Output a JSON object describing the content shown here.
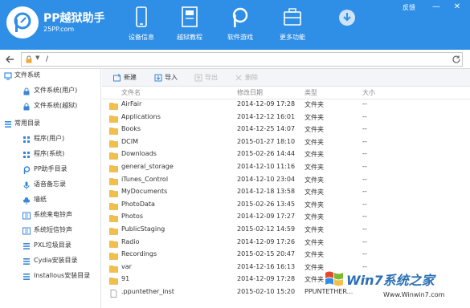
{
  "colors": {
    "header_bg": "#2f8fe6",
    "folder": "#f2c04a",
    "folder_dark": "#d9a12b",
    "accent": "#2f8fe6"
  },
  "header": {
    "brand": "PP越狱助手",
    "brand_url": "25PP.com",
    "feedback": "反馈",
    "nav": [
      {
        "label": "设备信息",
        "icon": "phone-icon"
      },
      {
        "label": "越狱教程",
        "icon": "book-icon"
      },
      {
        "label": "软件游戏",
        "icon": "pp-app-icon"
      },
      {
        "label": "更多功能",
        "icon": "toolbox-icon"
      },
      {
        "label": "",
        "icon": "download-icon"
      }
    ],
    "window_controls": [
      "minimize-icon",
      "close-icon"
    ]
  },
  "address": {
    "path": "/"
  },
  "sidebar": {
    "sections": [
      {
        "label": "文件系统",
        "icon": "monitor-icon",
        "items": [
          {
            "label": "文件系统(用户)",
            "icon": "lock-icon"
          },
          {
            "label": "文件系统(越狱)",
            "icon": "lock-icon"
          }
        ]
      },
      {
        "label": "常用目录",
        "icon": "list-icon",
        "items": [
          {
            "label": "程序(用户)",
            "icon": "apps-icon"
          },
          {
            "label": "程序(系统)",
            "icon": "apps-icon"
          },
          {
            "label": "PP助手目录",
            "icon": "pp-icon"
          },
          {
            "label": "语音备忘录",
            "icon": "mic-icon"
          },
          {
            "label": "墙纸",
            "icon": "flower-icon"
          },
          {
            "label": "系统来电铃声",
            "icon": "ringtone-icon"
          },
          {
            "label": "系统短信铃声",
            "icon": "ringtone-icon"
          },
          {
            "label": "PXL垃圾目录",
            "icon": "list-icon"
          },
          {
            "label": "Cydia安装目录",
            "icon": "list-icon"
          },
          {
            "label": "Installous安装目录",
            "icon": "list-icon"
          }
        ]
      }
    ]
  },
  "toolbar": {
    "buttons": [
      {
        "label": "新建",
        "icon": "new-folder-icon",
        "enabled": true
      },
      {
        "label": "导入",
        "icon": "import-icon",
        "enabled": true
      },
      {
        "label": "导出",
        "icon": "export-icon",
        "enabled": false
      },
      {
        "label": "删除",
        "icon": "delete-icon",
        "enabled": false
      }
    ]
  },
  "table": {
    "columns": [
      "文件名",
      "修改日期",
      "类型",
      "大小"
    ],
    "rows": [
      {
        "name": "AirFair",
        "date": "2014-12-09 17:28",
        "type": "文件夹",
        "size": "--",
        "kind": "folder"
      },
      {
        "name": "Applications",
        "date": "2014-12-12 16:01",
        "type": "文件夹",
        "size": "--",
        "kind": "folder"
      },
      {
        "name": "Books",
        "date": "2014-12-25 14:07",
        "type": "文件夹",
        "size": "--",
        "kind": "folder"
      },
      {
        "name": "DCIM",
        "date": "2015-01-27 18:10",
        "type": "文件夹",
        "size": "--",
        "kind": "folder"
      },
      {
        "name": "Downloads",
        "date": "2015-02-26 14:44",
        "type": "文件夹",
        "size": "--",
        "kind": "folder"
      },
      {
        "name": "general_storage",
        "date": "2014-12-10 11:16",
        "type": "文件夹",
        "size": "--",
        "kind": "folder"
      },
      {
        "name": "iTunes_Control",
        "date": "2014-12-10 23:04",
        "type": "文件夹",
        "size": "--",
        "kind": "folder"
      },
      {
        "name": "MyDocuments",
        "date": "2014-12-18 13:58",
        "type": "文件夹",
        "size": "--",
        "kind": "folder"
      },
      {
        "name": "PhotoData",
        "date": "2015-02-26 13:45",
        "type": "文件夹",
        "size": "--",
        "kind": "folder"
      },
      {
        "name": "Photos",
        "date": "2014-12-09 17:27",
        "type": "文件夹",
        "size": "--",
        "kind": "folder"
      },
      {
        "name": "PublicStaging",
        "date": "2015-02-12 14:59",
        "type": "文件夹",
        "size": "--",
        "kind": "folder"
      },
      {
        "name": "Radio",
        "date": "2014-12-09 17:26",
        "type": "文件夹",
        "size": "--",
        "kind": "folder"
      },
      {
        "name": "Recordings",
        "date": "2015-02-15 20:47",
        "type": "文件夹",
        "size": "--",
        "kind": "folder"
      },
      {
        "name": "var",
        "date": "2014-12-16 16:13",
        "type": "文件夹",
        "size": "--",
        "kind": "folder"
      },
      {
        "name": "91",
        "date": "2014-12-09 17:28",
        "type": "文件夹",
        "size": "--",
        "kind": "folder"
      },
      {
        "name": ".ppuntether_inst",
        "date": "2015-02-10 15:20",
        "type": "PPUNTETHER...",
        "size": "",
        "kind": "file"
      }
    ]
  },
  "watermark": {
    "brand": "Win7系统之家",
    "url": "Www.Winwin7.com"
  }
}
